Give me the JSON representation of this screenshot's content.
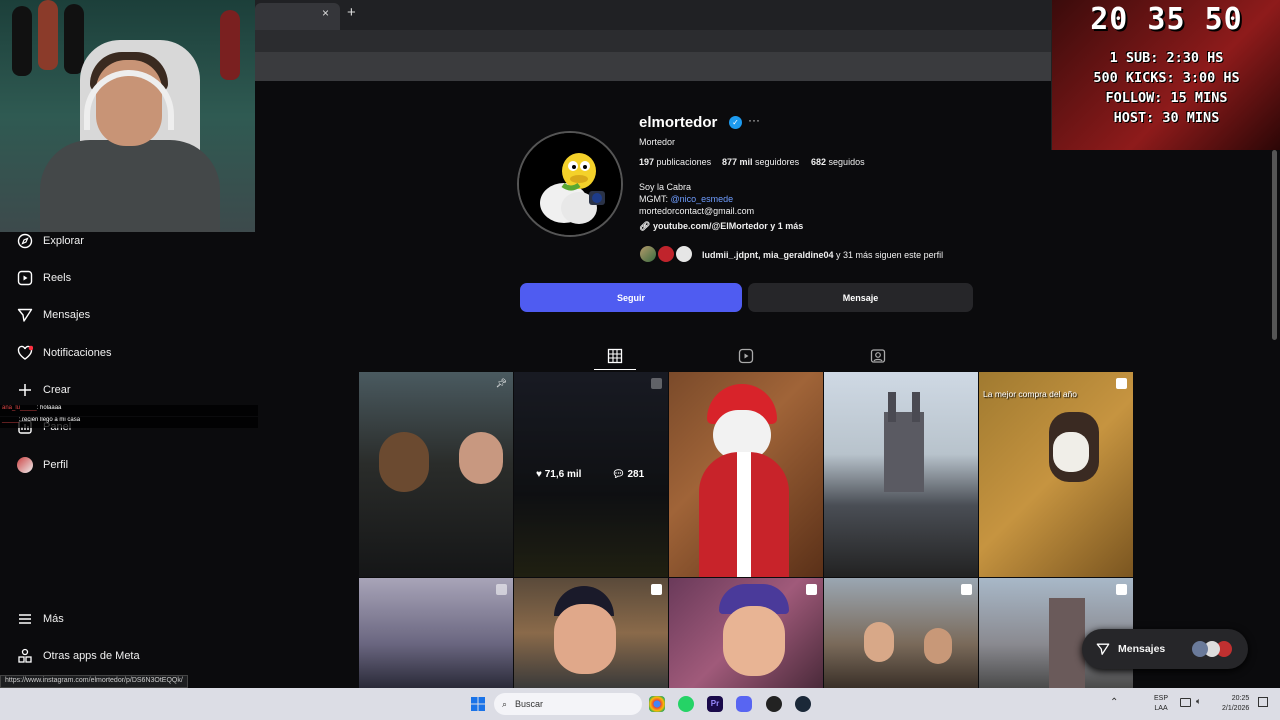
{
  "browser": {
    "tab_close": "×",
    "new_tab": "+"
  },
  "stream_overlay": {
    "timer": "20 35 50",
    "lines": [
      "1 SUB: 2:30 HS",
      "500 KICKS: 3:00 HS",
      "FOLLOW: 15 MINS",
      "HOST: 30 MINS"
    ]
  },
  "sidebar": {
    "items": [
      {
        "label": "Explorar",
        "icon": "compass-icon"
      },
      {
        "label": "Reels",
        "icon": "reels-icon"
      },
      {
        "label": "Mensajes",
        "icon": "send-icon"
      },
      {
        "label": "Notificaciones",
        "icon": "heart-icon"
      },
      {
        "label": "Crear",
        "icon": "plus-icon"
      },
      {
        "label": "Panel",
        "icon": "dashboard-icon"
      },
      {
        "label": "Perfil",
        "icon": "avatar"
      }
    ],
    "more": "Más",
    "meta_apps": "Otras apps de Meta"
  },
  "chat": [
    {
      "user": "ana_lu_____",
      "text": ": holaaaa"
    },
    {
      "user": "_____",
      "text": ": recién llego a mi casa"
    }
  ],
  "profile": {
    "username": "elmortedor",
    "full_name": "Mortedor",
    "posts_count": "197",
    "posts_label": "publicaciones",
    "followers_count": "877 mil",
    "followers_label": "seguidores",
    "following_count": "682",
    "following_label": "seguidos",
    "bio_line1": "Soy la Cabra",
    "mgmt_prefix": "MGMT: ",
    "mgmt_handle": "@nico_esmede",
    "email": "mortedorcontact@gmail.com",
    "link": "youtube.com/@ElMortedor y 1 más",
    "followed_by_names": "ludmii_.jdpnt, mia_geraldine04",
    "followed_by_rest": " y 31 más siguen este perfil"
  },
  "buttons": {
    "follow": "Seguir",
    "message": "Mensaje"
  },
  "grid": {
    "hover_likes": "71,6 mil",
    "hover_comments": "281",
    "caption_5": "La mejor compra del año"
  },
  "floating": {
    "messages": "Mensajes"
  },
  "status_url": "https://www.instagram.com/elmortedor/p/DS6N3OtEQQk/",
  "taskbar": {
    "search": "Buscar",
    "lang1": "ESP",
    "lang2": "LAA",
    "time": "20:25",
    "date": "2/1/2026"
  },
  "colors": {
    "accent": "#4f5cf1",
    "verified": "#1d9bf0",
    "link": "#6f9dff"
  }
}
